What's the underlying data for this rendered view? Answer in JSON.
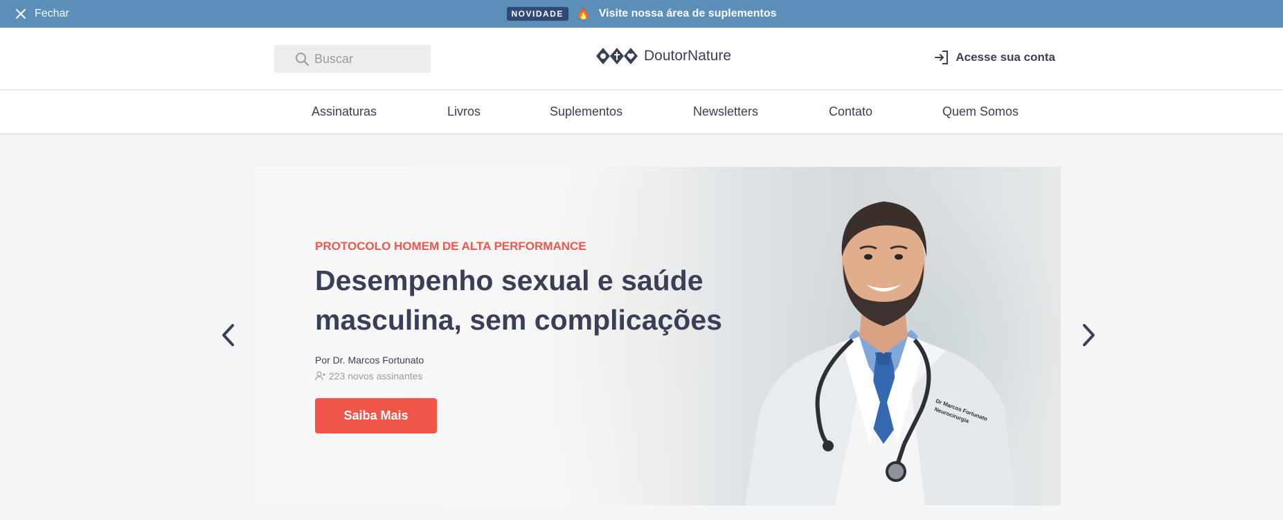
{
  "topbar": {
    "close_label": "Fechar",
    "badge": "NOVIDADE",
    "fire_icon": "🔥",
    "promo_text": "Visite nossa área de suplementos",
    "bg_color": "#5b8fba"
  },
  "header": {
    "search_placeholder": "Buscar",
    "logo_text": "DoutorNature",
    "account_label": "Acesse sua conta"
  },
  "nav": {
    "items": [
      {
        "label": "Assinaturas"
      },
      {
        "label": "Livros"
      },
      {
        "label": "Suplementos"
      },
      {
        "label": "Newsletters"
      },
      {
        "label": "Contato"
      },
      {
        "label": "Quem Somos"
      }
    ]
  },
  "hero": {
    "kicker": "PROTOCOLO HOMEM DE ALTA PERFORMANCE",
    "title": "Desempenho sexual e saúde masculina, sem complicações",
    "author": "Por Dr. Marcos Fortunato",
    "subscribers": "223 novos assinantes",
    "cta_label": "Saiba Mais",
    "coat_embroidery_line1": "Dr Marcos Fortunato",
    "coat_embroidery_line2": "Neurocirurgia",
    "accent_color": "#f2564a"
  }
}
